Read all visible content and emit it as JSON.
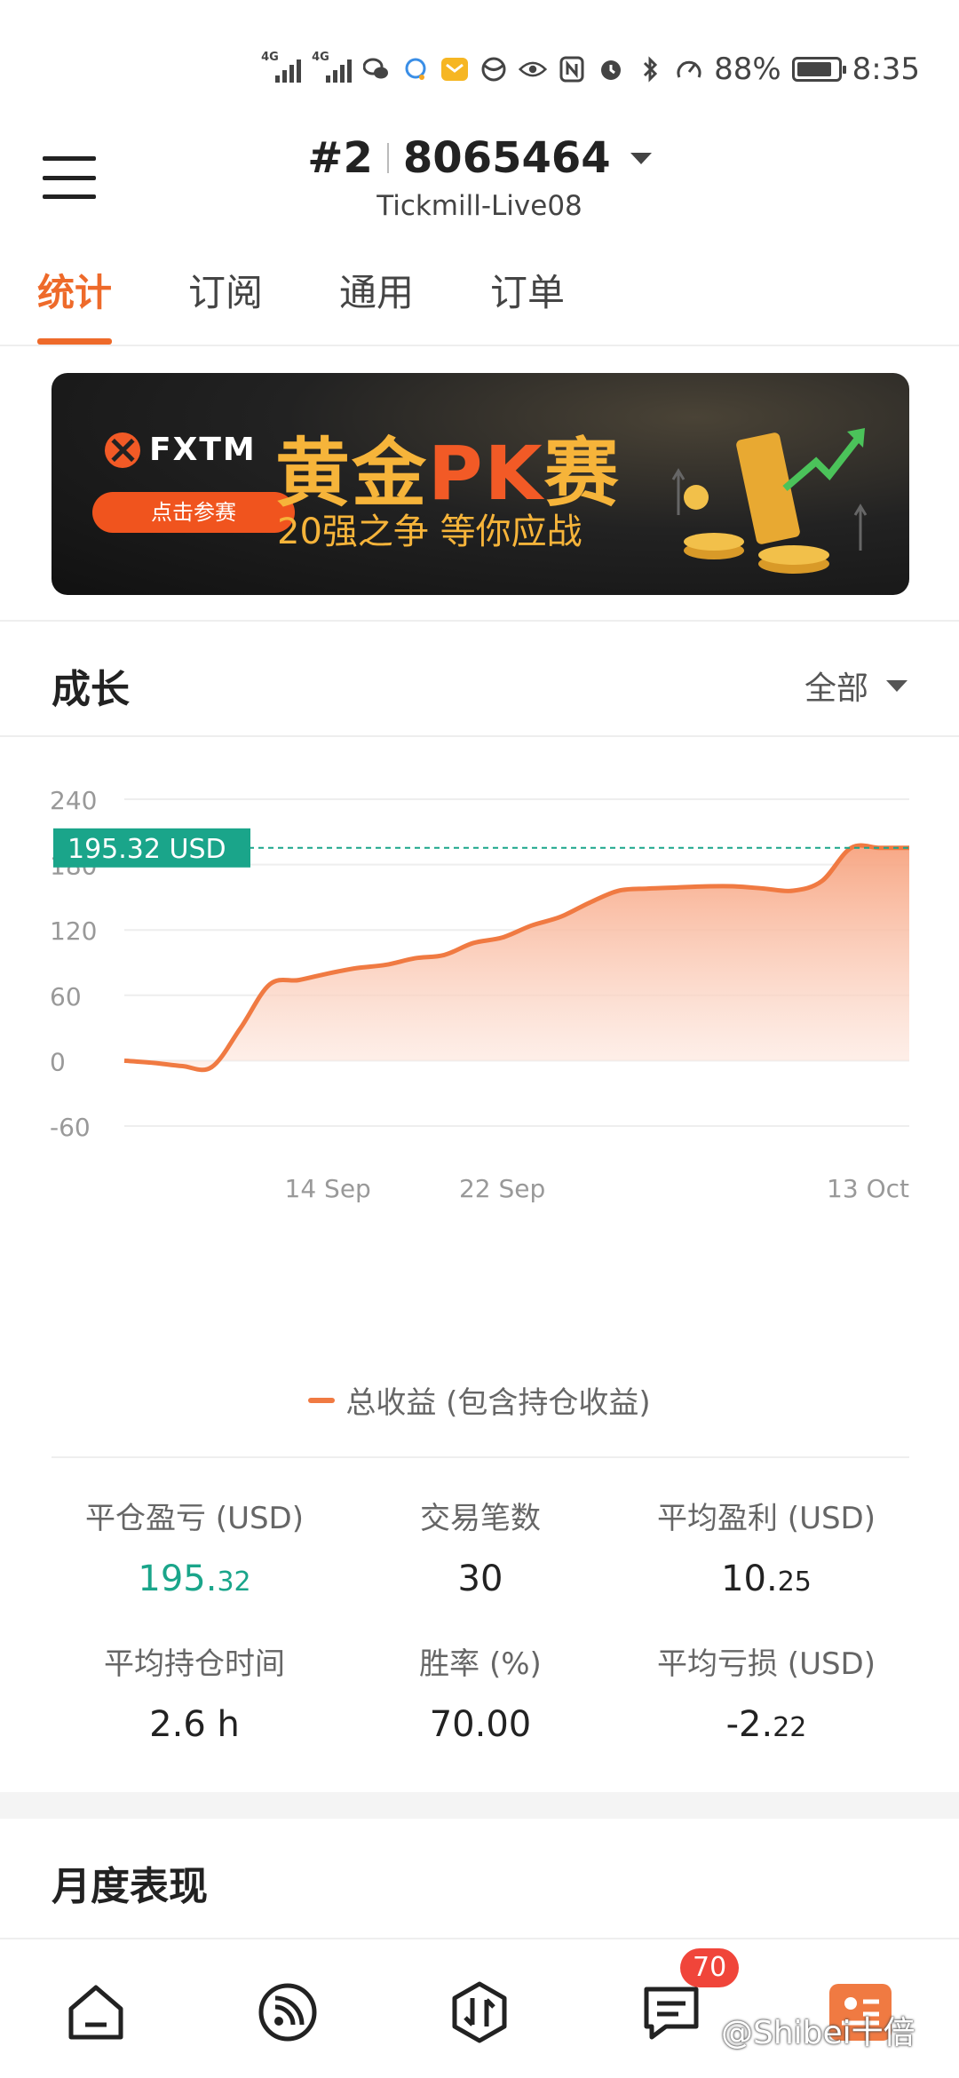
{
  "status_bar": {
    "net1": "4G",
    "net2": "4G",
    "battery_pct": "88%",
    "battery_level": 0.88,
    "time": "8:35"
  },
  "header": {
    "account_index": "#2",
    "account_number": "8065464",
    "server": "Tickmill-Live08"
  },
  "tabs": [
    {
      "label": "统计",
      "active": true
    },
    {
      "label": "订阅",
      "active": false
    },
    {
      "label": "通用",
      "active": false
    },
    {
      "label": "订单",
      "active": false
    }
  ],
  "banner": {
    "brand": "FXTM",
    "button": "点击参赛",
    "title_part1": "黄金",
    "title_part2": "PK",
    "title_part3": "赛",
    "subtitle": "20强之争  等你应战"
  },
  "growth": {
    "title": "成长",
    "range": "全部"
  },
  "chart_data": {
    "type": "area",
    "y_ticks": [
      "240",
      "180",
      "120",
      "60",
      "0",
      "-60"
    ],
    "ylim": [
      -60,
      240
    ],
    "x_tick_labels": [
      "14 Sep",
      "22 Sep",
      "13 Oct"
    ],
    "x_tick_idx": [
      7,
      13,
      27
    ],
    "current_label": "195.32 USD",
    "current_value": 195.32,
    "series": [
      {
        "name": "总收益 (包含持仓收益)",
        "color": "#f07a42",
        "values": [
          0,
          -2,
          -5,
          -6,
          30,
          70,
          74,
          80,
          85,
          88,
          94,
          97,
          108,
          113,
          124,
          132,
          145,
          156,
          158,
          159,
          160,
          160,
          158,
          156,
          165,
          195.32,
          195.32,
          195.32
        ]
      }
    ]
  },
  "stats": {
    "closed_pl_label": "平仓盈亏 (USD)",
    "closed_pl_int": "195.",
    "closed_pl_frac": "32",
    "trades_label": "交易笔数",
    "trades_value": "30",
    "avg_profit_label": "平均盈利 (USD)",
    "avg_profit_int": "10.",
    "avg_profit_frac": "25",
    "avg_hold_label": "平均持仓时间",
    "avg_hold_value": "2.6 h",
    "win_rate_label": "胜率 (%)",
    "win_rate_value": "70.00",
    "avg_loss_label": "平均亏损 (USD)",
    "avg_loss_int": "-2.",
    "avg_loss_frac": "22"
  },
  "monthly": {
    "title": "月度表现"
  },
  "bottom_nav": {
    "badge": "70",
    "watermark": "@Shibei十倍"
  }
}
